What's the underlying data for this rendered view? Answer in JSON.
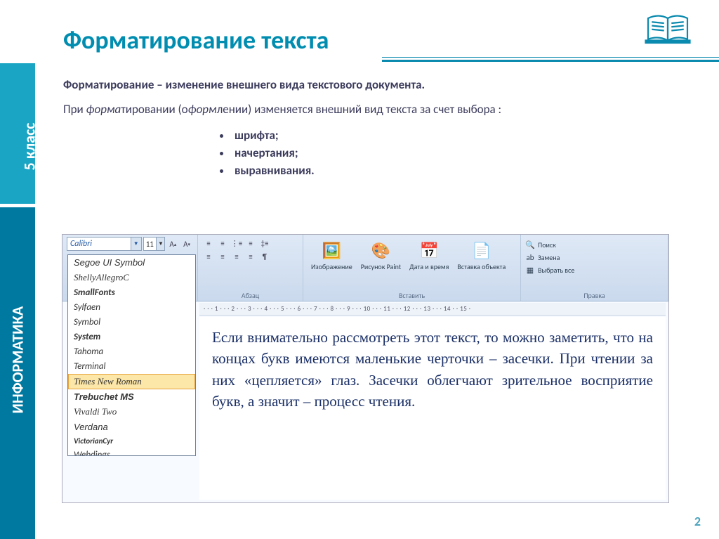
{
  "sidebar": {
    "grade": "5 класс",
    "subject": "ИНФОРМАТИКА"
  },
  "header": {
    "title": "Форматирование текста"
  },
  "definition": "Форматирование – изменение внешнего вида текстового документа.",
  "body": {
    "pre_italic1": "При ",
    "italic1": "форма",
    "mid1": "тировании (о",
    "italic2": "форм",
    "post": "лении) изменяется внешний вид текста за счет выбора :"
  },
  "list": [
    "шрифта;",
    "начертания;",
    "выравнивания."
  ],
  "ribbon": {
    "font": {
      "name": "Calibri",
      "size": "11",
      "group_label": ""
    },
    "paragraph": {
      "group_label": "Абзац"
    },
    "insert": {
      "group_label": "Вставить",
      "image": "Изображение",
      "paint": "Рисунок Paint",
      "datetime": "Дата и время",
      "object": "Вставка объекта"
    },
    "edit": {
      "group_label": "Правка",
      "find": "Поиск",
      "replace": "Замена",
      "selectall": "Выбрать все"
    }
  },
  "fonts": [
    "Segoe UI Symbol",
    "ShellyAllegroC",
    "SmallFonts",
    "Sylfaen",
    "Symbol",
    "System",
    "Tahoma",
    "Terminal",
    "Times New Roman",
    "Trebuchet MS",
    "Vivaldi Two",
    "Verdana",
    "VictorianCyr",
    "Webdings"
  ],
  "ruler": "· · · 1 · · · 2 · · · 3 · · · 4 · · · 5 · · · 6 · · · 7 · · · 8 · · · 9 · · · 10 · · · 11 · · · 12 · · · 13 · · · 14 · · 15 ·",
  "doc": "Если внимательно рассмотреть этот текст, то можно заметить, что на концах букв имеются маленькие черточки – засечки. При чтении за них «цепляется» глаз. Засечки облегчают зрительное восприятие букв, а значит – процесс чтения.",
  "page": "2"
}
